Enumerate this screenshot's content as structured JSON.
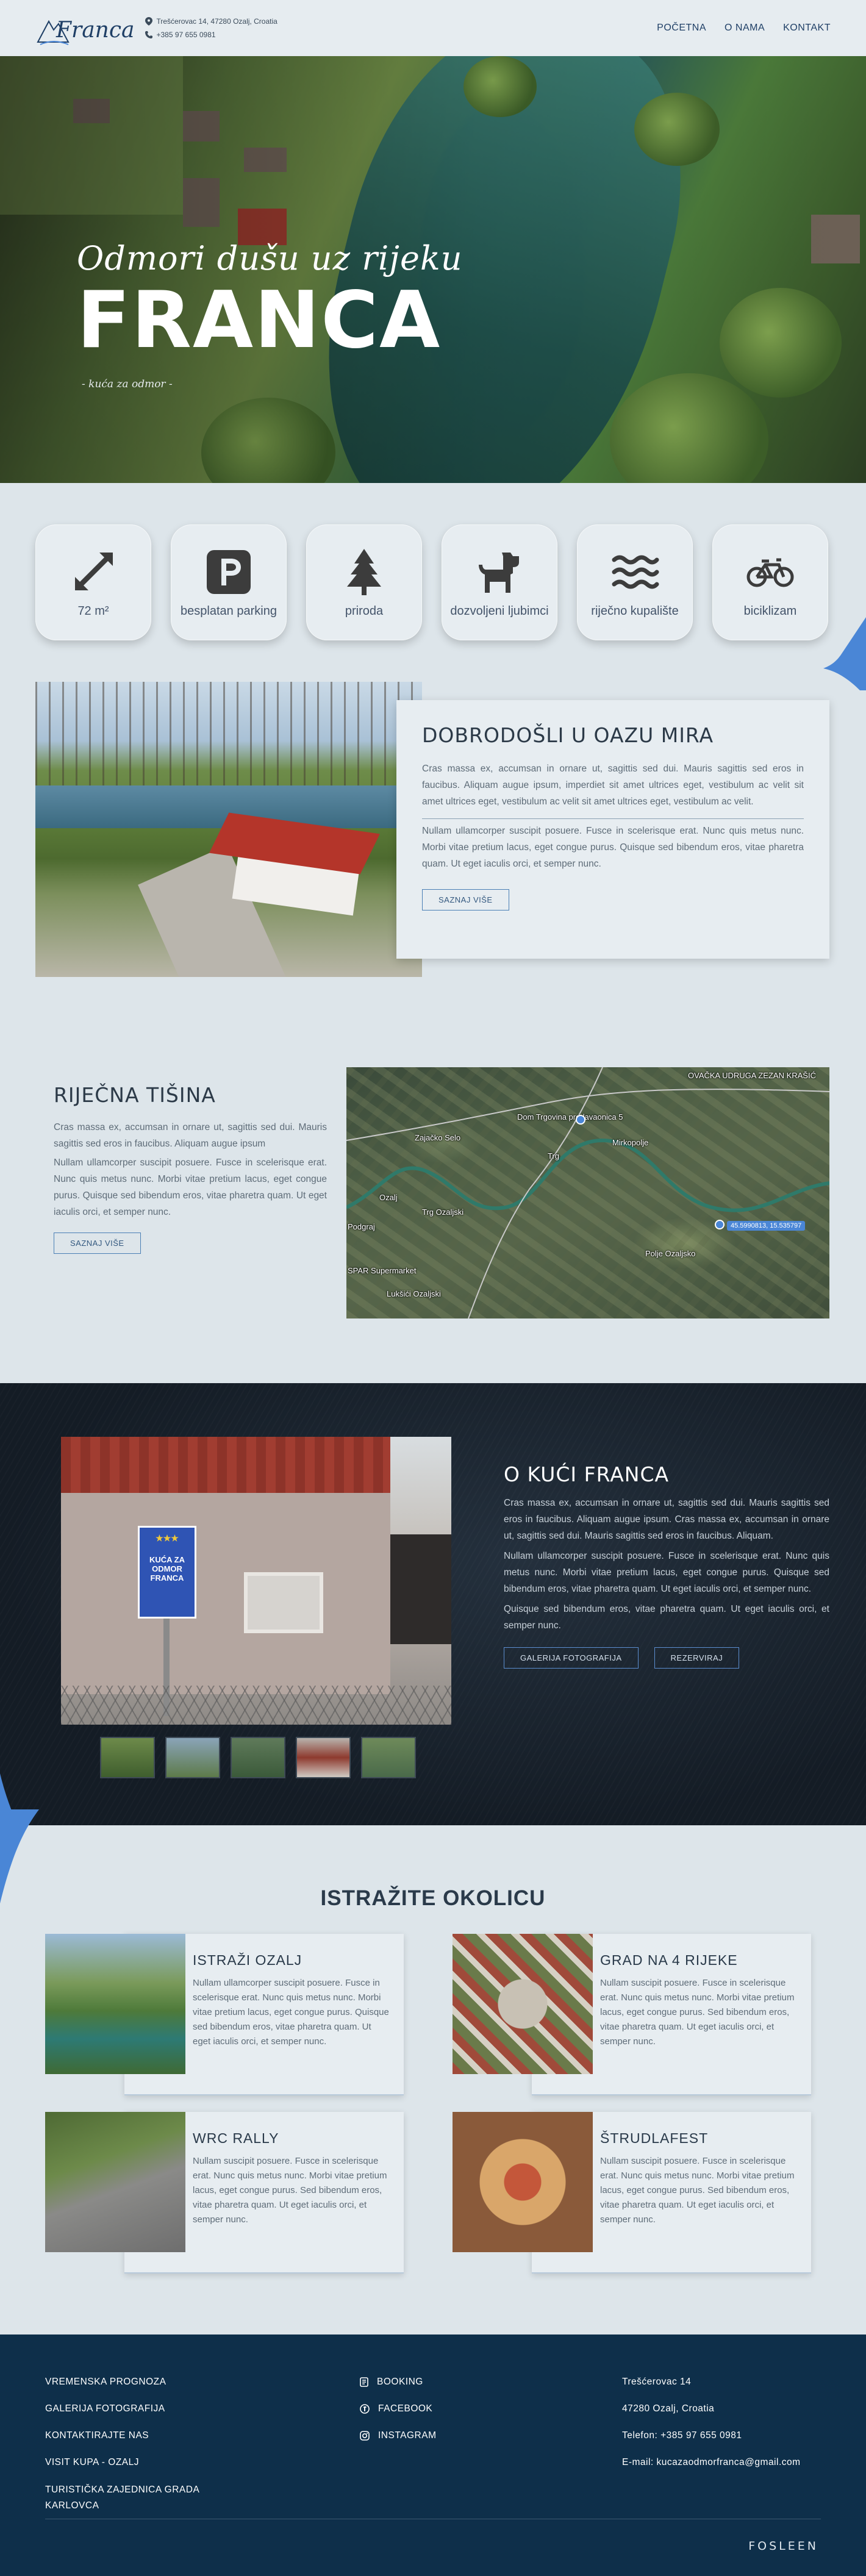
{
  "header": {
    "logo_text": "Franca",
    "address": "Trešćerovac 14, 47280 Ozalj, Croatia",
    "phone": "+385 97 655 0981",
    "nav": [
      "POČETNA",
      "O NAMA",
      "KONTAKT"
    ]
  },
  "hero": {
    "script": "Odmori dušu uz rijeku",
    "title": "FRANCA",
    "subtitle": "- kuća za odmor -"
  },
  "amenities": [
    {
      "icon": "resize-arrows-icon",
      "label": "72 m²"
    },
    {
      "icon": "parking-icon",
      "label": "besplatan parking"
    },
    {
      "icon": "tree-icon",
      "label": "priroda"
    },
    {
      "icon": "dog-icon",
      "label": "dozvoljeni ljubimci"
    },
    {
      "icon": "water-waves-icon",
      "label": "riječno kupalište"
    },
    {
      "icon": "bicycle-icon",
      "label": "biciklizam"
    }
  ],
  "welcome": {
    "title": "DOBRODOŠLI U OAZU MIRA",
    "p1": "Cras massa ex,  accumsan in ornare ut, sagittis sed dui. Mauris sagittis sed eros in  faucibus. Aliquam augue ipsum, imperdiet sit amet ultrices eget, vestibulum ac velit sit amet ultrices eget,  vestibulum ac velit  sit amet ultrices eget,  vestibulum ac velit.",
    "p2": "Nullam ullamcorper suscipit posuere. Fusce in  scelerisque erat. Nunc quis metus nunc. Morbi vitae pretium lacus, eget  congue purus. Quisque sed bibendum eros, vitae pharetra quam. Ut eget  iaculis orci, et semper nunc.",
    "button": "SAZNAJ VIŠE"
  },
  "river": {
    "title": "RIJEČNA TIŠINA",
    "p1": "Cras massa ex,  accumsan in ornare ut, sagittis sed dui. Mauris sagittis sed eros in  faucibus. Aliquam augue ipsum",
    "p2": "Nullam ullamcorper suscipit posuere. Fusce in  scelerisque erat. Nunc quis metus nunc. Morbi vitae pretium lacus, eget  congue purus. Quisque sed bibendum eros, vitae pharetra quam. Ut eget  iaculis orci, et semper nunc.",
    "button": "SAZNAJ VIŠE",
    "map_labels": [
      "OVAČKA UDRUGA ZEZAN KRAŠIĆ",
      "Dom Trgovina prodavaonica 5",
      "Zajačko Selo",
      "Trg",
      "Mirkopolje",
      "Ozalj",
      "Podgraj",
      "SPAR Supermarket",
      "Lukšići Ozaljski",
      "Polje Ozaljsko",
      "Trg Ozaljski"
    ],
    "map_coord": "45.5990813, 15.535797"
  },
  "house": {
    "title": "O KUĆI FRANCA",
    "p1": "Cras massa ex,  accumsan in ornare ut, sagittis sed dui. Mauris sagittis sed eros in  faucibus. Aliquam augue ipsum. Cras massa ex,  accumsan in ornare ut, sagittis sed dui. Mauris sagittis sed eros in  faucibus. Aliquam.",
    "p2": "Nullam ullamcorper suscipit posuere. Fusce in  scelerisque erat. Nunc quis metus nunc. Morbi vitae pretium lacus, eget  congue purus. Quisque sed bibendum eros, vitae pharetra quam. Ut eget  iaculis orci, et semper nunc.",
    "p3": " Quisque sed bibendum eros, vitae pharetra quam. Ut eget  iaculis orci, et semper nunc.",
    "button1": "GALERIJA FOTOGRAFIJA",
    "button2": "REZERVIRAJ",
    "sign_text": "KUĆA ZA ODMOR FRANCA",
    "sign_stars": "★★★"
  },
  "explore": {
    "title": "ISTRAŽITE OKOLICU",
    "cards": [
      {
        "title": "ISTRAŽI OZALJ",
        "text": "Nullam ullamcorper suscipit posuere. Fusce in  scelerisque erat. Nunc quis metus nunc. Morbi vitae pretium lacus, eget  congue purus. Quisque sed bibendum eros, vitae pharetra quam. Ut eget  iaculis orci, et semper nunc."
      },
      {
        "title": "GRAD NA 4 RIJEKE",
        "text": "Nullam suscipit posuere. Fusce in scelerisque erat. Nunc quis metus nunc. Morbi vitae pretium lacus, eget  congue purus. Sed bibendum eros, vitae pharetra quam. Ut eget  iaculis orci, et semper nunc."
      },
      {
        "title": "WRC RALLY",
        "text": "Nullam suscipit posuere. Fusce in scelerisque erat. Nunc quis metus nunc. Morbi vitae pretium lacus, eget  congue purus. Sed bibendum eros, vitae pharetra quam. Ut eget  iaculis orci, et semper nunc."
      },
      {
        "title": "ŠTRUDLAFEST",
        "text": "Nullam suscipit posuere. Fusce in scelerisque erat. Nunc quis metus nunc. Morbi vitae pretium lacus, eget  congue purus. Sed bibendum eros, vitae pharetra quam. Ut eget  iaculis orci, et semper nunc."
      }
    ]
  },
  "footer": {
    "links": [
      "VREMENSKA PROGNOZA",
      "GALERIJA FOTOGRAFIJA",
      "KONTAKTIRAJTE NAS",
      "VISIT KUPA - OZALJ",
      "TURISTIČKA ZAJEDNICA GRADA KARLOVCA"
    ],
    "social": [
      {
        "icon": "booking-icon",
        "label": "BOOKING"
      },
      {
        "icon": "facebook-icon",
        "label": "FACEBOOK"
      },
      {
        "icon": "instagram-icon",
        "label": "INSTAGRAM"
      }
    ],
    "address1": "Trešćerovac 14",
    "address2": "47280 Ozalj, Croatia",
    "phone": "Telefon: +385 97 655 0981",
    "email_label": "E-mail: ",
    "email": "kucazaodmorfranca@gmail.com",
    "signature": "FOSLEEN"
  },
  "colors": {
    "accent": "#4a86d6",
    "footer_bg": "#0e2f4a",
    "page_bg": "#dde5ea"
  }
}
